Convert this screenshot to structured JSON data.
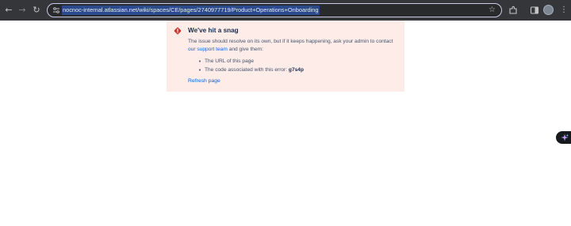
{
  "browser": {
    "url": "nocnoc-internal.atlassian.net/wiki/spaces/CE/pages/2740977719/Product+Operations+Onboarding",
    "icons": [
      "back-icon",
      "forward-icon",
      "reload-icon",
      "site-info-icon",
      "bookmark-star-icon",
      "extensions-icon",
      "side-panel-icon",
      "profile-avatar",
      "more-menu-icon"
    ]
  },
  "error": {
    "title": "We've hit a snag",
    "desc_before_link": "The issue should resolve on its own, but if it keeps happening, ask your admin to contact ",
    "link_text": "our support team",
    "desc_after_link": " and give them:",
    "items": [
      {
        "text": "The URL of this page"
      },
      {
        "text": "The code associated with this error: ",
        "code": "g7s4p"
      }
    ],
    "refresh_label": "Refresh page",
    "colors": {
      "panel_bg": "#fdece8",
      "icon": "#c9372c",
      "link": "#0c66e4",
      "title": "#172b4d"
    }
  },
  "floating_button": {
    "icon": "ai-sparkle-icon"
  }
}
